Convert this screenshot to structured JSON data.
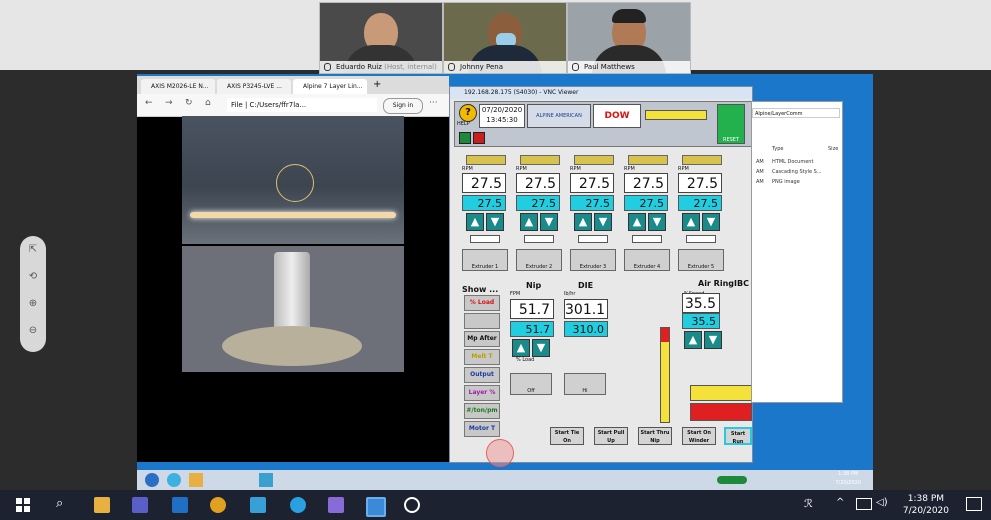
{
  "participants": [
    {
      "name": "Eduardo Ruiz",
      "sub": "(Host, internal)"
    },
    {
      "name": "Johnny Pena",
      "sub": ""
    },
    {
      "name": "Paul Matthews",
      "sub": ""
    }
  ],
  "zoom_controls": [
    "⇱",
    "⟲",
    "⊕",
    "⊖"
  ],
  "browser": {
    "tabs": [
      "AXIS M2026-LE N...",
      "AXIS P3245-LVE ...",
      "Alpine 7 Layer Lin..."
    ],
    "url": "File | C:/Users/ffr7la...",
    "sign_in": "Sign in"
  },
  "vnc": {
    "title": "192.168.28.175 (S4030) - VNC Viewer",
    "date": "07/20/2020",
    "time": "13:45:30",
    "help": "HELP",
    "brand1": "ALPINE AMERICAN",
    "brand2": "DOW",
    "reset": "RESET",
    "extruders": [
      {
        "label": "Extruder 1",
        "rpm": "27.5",
        "set": "27.5"
      },
      {
        "label": "Extruder 2",
        "rpm": "27.5",
        "set": "27.5"
      },
      {
        "label": "Extruder 3",
        "rpm": "27.5",
        "set": "27.5"
      },
      {
        "label": "Extruder 4",
        "rpm": "27.5",
        "set": "27.5"
      },
      {
        "label": "Extruder 5",
        "rpm": "27.5",
        "set": "27.5"
      }
    ],
    "rpm_label": "RPM",
    "show_label": "Show ...",
    "show_buttons": [
      "% Load",
      "",
      "Mp After",
      "Melt T",
      "Output",
      "Layer %",
      "#/ton/pm",
      "Motor T"
    ],
    "nip": {
      "title": "Nip",
      "unit": "FPM",
      "value": "51.7",
      "set": "51.7",
      "load": "% Load",
      "btn": "Off"
    },
    "die": {
      "title": "DIE",
      "unit": "lb/hr",
      "value": "301.1",
      "set": "310.0",
      "btn": "Hi"
    },
    "air_ring": {
      "title": "Air Ring",
      "unit": "%Speed",
      "value": "35.5",
      "set": "35.5"
    },
    "ibc": {
      "title": "IBC"
    },
    "start_buttons": [
      "Start Tie On",
      "Start Pull Up",
      "Start Thru Nip",
      "Start On Winder",
      "Start Run"
    ]
  },
  "explorer": {
    "path": "Alpine/LayerComm",
    "column_type": "Type",
    "column_size": "Size",
    "items": [
      {
        "time": "AM",
        "type": "HTML Document"
      },
      {
        "time": "AM",
        "type": "Cascading Style S..."
      },
      {
        "time": "AM",
        "type": "PNG image"
      }
    ]
  },
  "inner_clock": {
    "time": "1:38 PM",
    "date": "7/20/2020"
  },
  "taskbar_clock": {
    "time": "1:38 PM",
    "date": "7/20/2020"
  }
}
